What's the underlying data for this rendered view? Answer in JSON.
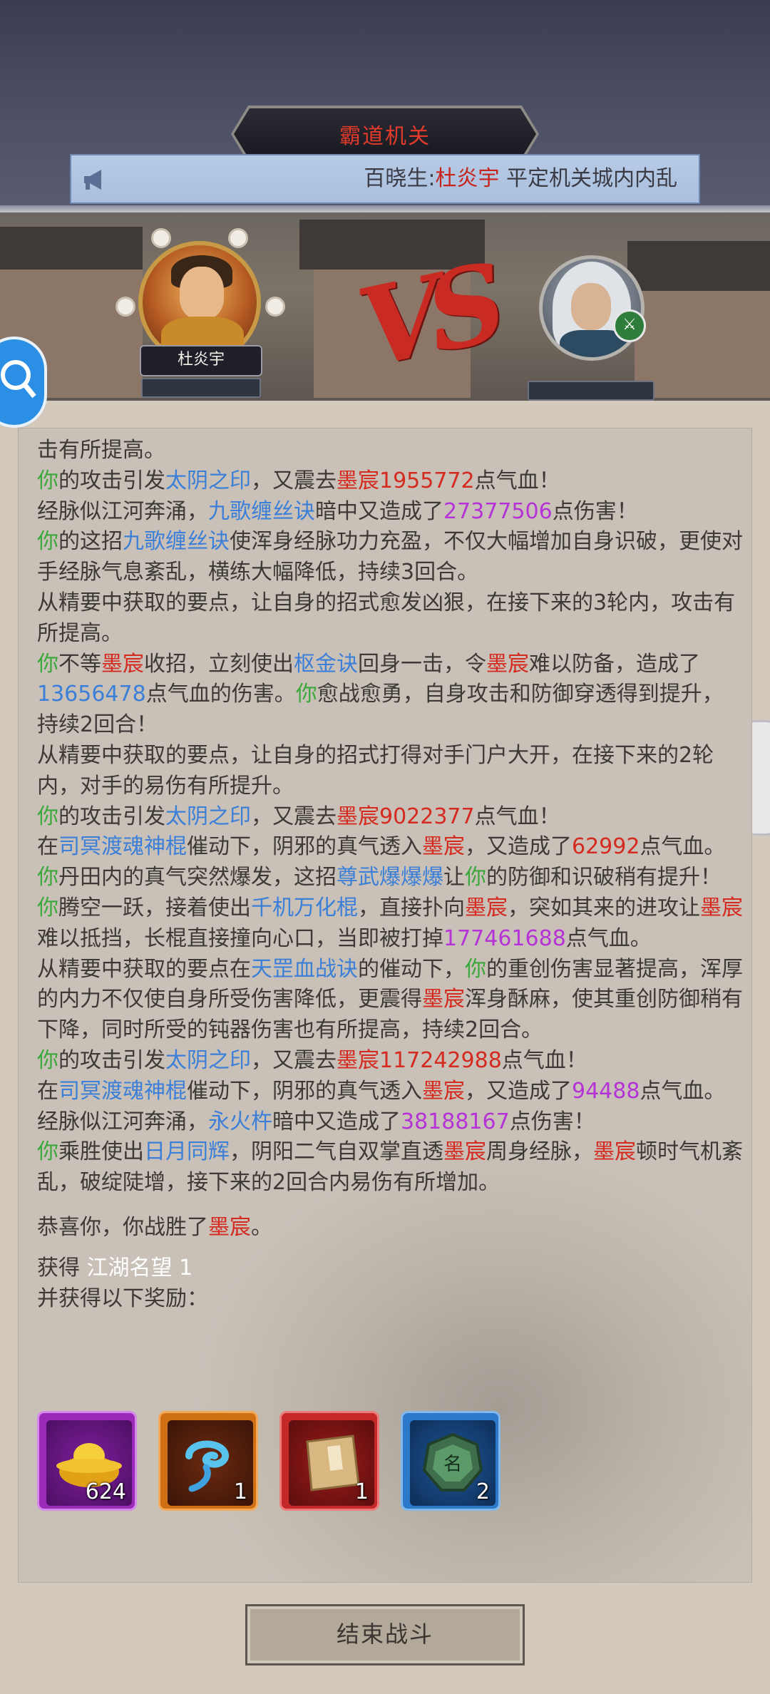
{
  "header": {
    "title": "霸道机关",
    "notice_prefix": "百晓生:",
    "notice_name": "杜炎宇",
    "notice_text": " 平定机关城内内乱"
  },
  "battle": {
    "player_name": "杜炎宇",
    "vs_label": "VS"
  },
  "log": [
    [
      {
        "t": "击有所提高。"
      }
    ],
    [
      {
        "t": "你",
        "c": "y"
      },
      {
        "t": "的攻击引发"
      },
      {
        "t": "太阴之印",
        "c": "b"
      },
      {
        "t": "，又震去"
      },
      {
        "t": "墨宸",
        "c": "r"
      },
      {
        "t": "1955772",
        "c": "r"
      },
      {
        "t": "点气血！"
      }
    ],
    [
      {
        "t": "经脉似江河奔涌，"
      },
      {
        "t": "九歌缠丝诀",
        "c": "b"
      },
      {
        "t": "暗中又造成了"
      },
      {
        "t": "27377506",
        "c": "p"
      },
      {
        "t": "点伤害！"
      }
    ],
    [
      {
        "t": "你",
        "c": "y"
      },
      {
        "t": "的这招"
      },
      {
        "t": "九歌缠丝诀",
        "c": "b"
      },
      {
        "t": "使浑身经脉功力充盈，不仅大幅增加自身识破，更使对手经脉气息紊乱，横练大幅降低，持续3回合。"
      }
    ],
    [
      {
        "t": "从精要中获取的要点，让自身的招式愈发凶狠，在接下来的3轮内，攻击有所提高。"
      }
    ],
    [
      {
        "t": "你",
        "c": "y"
      },
      {
        "t": "不等"
      },
      {
        "t": "墨宸",
        "c": "r"
      },
      {
        "t": "收招，立刻使出"
      },
      {
        "t": "枢金诀",
        "c": "b"
      },
      {
        "t": "回身一击，令"
      },
      {
        "t": "墨宸",
        "c": "r"
      },
      {
        "t": "难以防备，造成了"
      },
      {
        "t": "13656478",
        "c": "b"
      },
      {
        "t": "点气血的伤害。"
      },
      {
        "t": "你",
        "c": "y"
      },
      {
        "t": "愈战愈勇，自身攻击和防御穿透得到提升，持续2回合！"
      }
    ],
    [
      {
        "t": "从精要中获取的要点，让自身的招式打得对手门户大开，在接下来的2轮内，对手的易伤有所提升。"
      }
    ],
    [
      {
        "t": "你",
        "c": "y"
      },
      {
        "t": "的攻击引发"
      },
      {
        "t": "太阴之印",
        "c": "b"
      },
      {
        "t": "，又震去"
      },
      {
        "t": "墨宸",
        "c": "r"
      },
      {
        "t": "9022377",
        "c": "r"
      },
      {
        "t": "点气血！"
      }
    ],
    [
      {
        "t": "在"
      },
      {
        "t": "司冥渡魂神棍",
        "c": "b"
      },
      {
        "t": "催动下，阴邪的真气透入"
      },
      {
        "t": "墨宸",
        "c": "r"
      },
      {
        "t": "，又造成了"
      },
      {
        "t": "62992",
        "c": "r"
      },
      {
        "t": "点气血。"
      }
    ],
    [
      {
        "t": "你",
        "c": "y"
      },
      {
        "t": "丹田内的真气突然爆发，这招"
      },
      {
        "t": "尊武爆爆爆",
        "c": "b"
      },
      {
        "t": "让"
      },
      {
        "t": "你",
        "c": "y"
      },
      {
        "t": "的防御和识破稍有提升！"
      }
    ],
    [
      {
        "t": "你",
        "c": "y"
      },
      {
        "t": "腾空一跃，接着使出"
      },
      {
        "t": "千机万化棍",
        "c": "b"
      },
      {
        "t": "，直接扑向"
      },
      {
        "t": "墨宸",
        "c": "r"
      },
      {
        "t": "，突如其来的进攻让"
      },
      {
        "t": "墨宸",
        "c": "r"
      },
      {
        "t": "难以抵挡，长棍直接撞向心口，当即被打掉"
      },
      {
        "t": "177461688",
        "c": "p"
      },
      {
        "t": "点气血。"
      }
    ],
    [
      {
        "t": "从精要中获取的要点在"
      },
      {
        "t": "天罡血战诀",
        "c": "b"
      },
      {
        "t": "的催动下，"
      },
      {
        "t": "你",
        "c": "y"
      },
      {
        "t": "的重创伤害显著提高，浑厚的内力不仅使自身所受伤害降低，更震得"
      },
      {
        "t": "墨宸",
        "c": "r"
      },
      {
        "t": "浑身酥麻，使其重创防御稍有下降，同时所受的钝器伤害也有所提高，持续2回合。"
      }
    ],
    [
      {
        "t": "你",
        "c": "y"
      },
      {
        "t": "的攻击引发"
      },
      {
        "t": "太阴之印",
        "c": "b"
      },
      {
        "t": "，又震去"
      },
      {
        "t": "墨宸",
        "c": "r"
      },
      {
        "t": "117242988",
        "c": "r"
      },
      {
        "t": "点气血！"
      }
    ],
    [
      {
        "t": "在"
      },
      {
        "t": "司冥渡魂神棍",
        "c": "b"
      },
      {
        "t": "催动下，阴邪的真气透入"
      },
      {
        "t": "墨宸",
        "c": "r"
      },
      {
        "t": "，又造成了"
      },
      {
        "t": "94488",
        "c": "p"
      },
      {
        "t": "点气血。"
      }
    ],
    [
      {
        "t": "经脉似江河奔涌，"
      },
      {
        "t": "永火杵",
        "c": "b"
      },
      {
        "t": "暗中又造成了"
      },
      {
        "t": "38188167",
        "c": "p"
      },
      {
        "t": "点伤害！"
      }
    ],
    [
      {
        "t": "你",
        "c": "y"
      },
      {
        "t": "乘胜使出"
      },
      {
        "t": "日月同辉",
        "c": "b"
      },
      {
        "t": "，阴阳二气自双掌直透"
      },
      {
        "t": "墨宸",
        "c": "r"
      },
      {
        "t": "周身经脉，"
      },
      {
        "t": "墨宸",
        "c": "r"
      },
      {
        "t": "顿时气机紊乱，破绽陡增，接下来的2回合内易伤有所增加。"
      }
    ]
  ],
  "result": {
    "victory_prefix": "恭喜你，你战胜了",
    "victory_target": "墨宸",
    "victory_suffix": "。",
    "gain_label": "获得 ",
    "gain_value": "江湖名望 1",
    "rewards_label": "并获得以下奖励："
  },
  "rewards": [
    {
      "icon": "gold-ingot-icon",
      "qty": "624"
    },
    {
      "icon": "blue-cloud-icon",
      "qty": "1"
    },
    {
      "icon": "book-icon",
      "qty": "1"
    },
    {
      "icon": "jade-token-icon",
      "qty": "2"
    }
  ],
  "end_button": "结束战斗",
  "colors": {
    "self": "#3aa83a",
    "enemy": "#d42a20",
    "skill": "#3b7fd8",
    "damage": "#b532d6"
  }
}
